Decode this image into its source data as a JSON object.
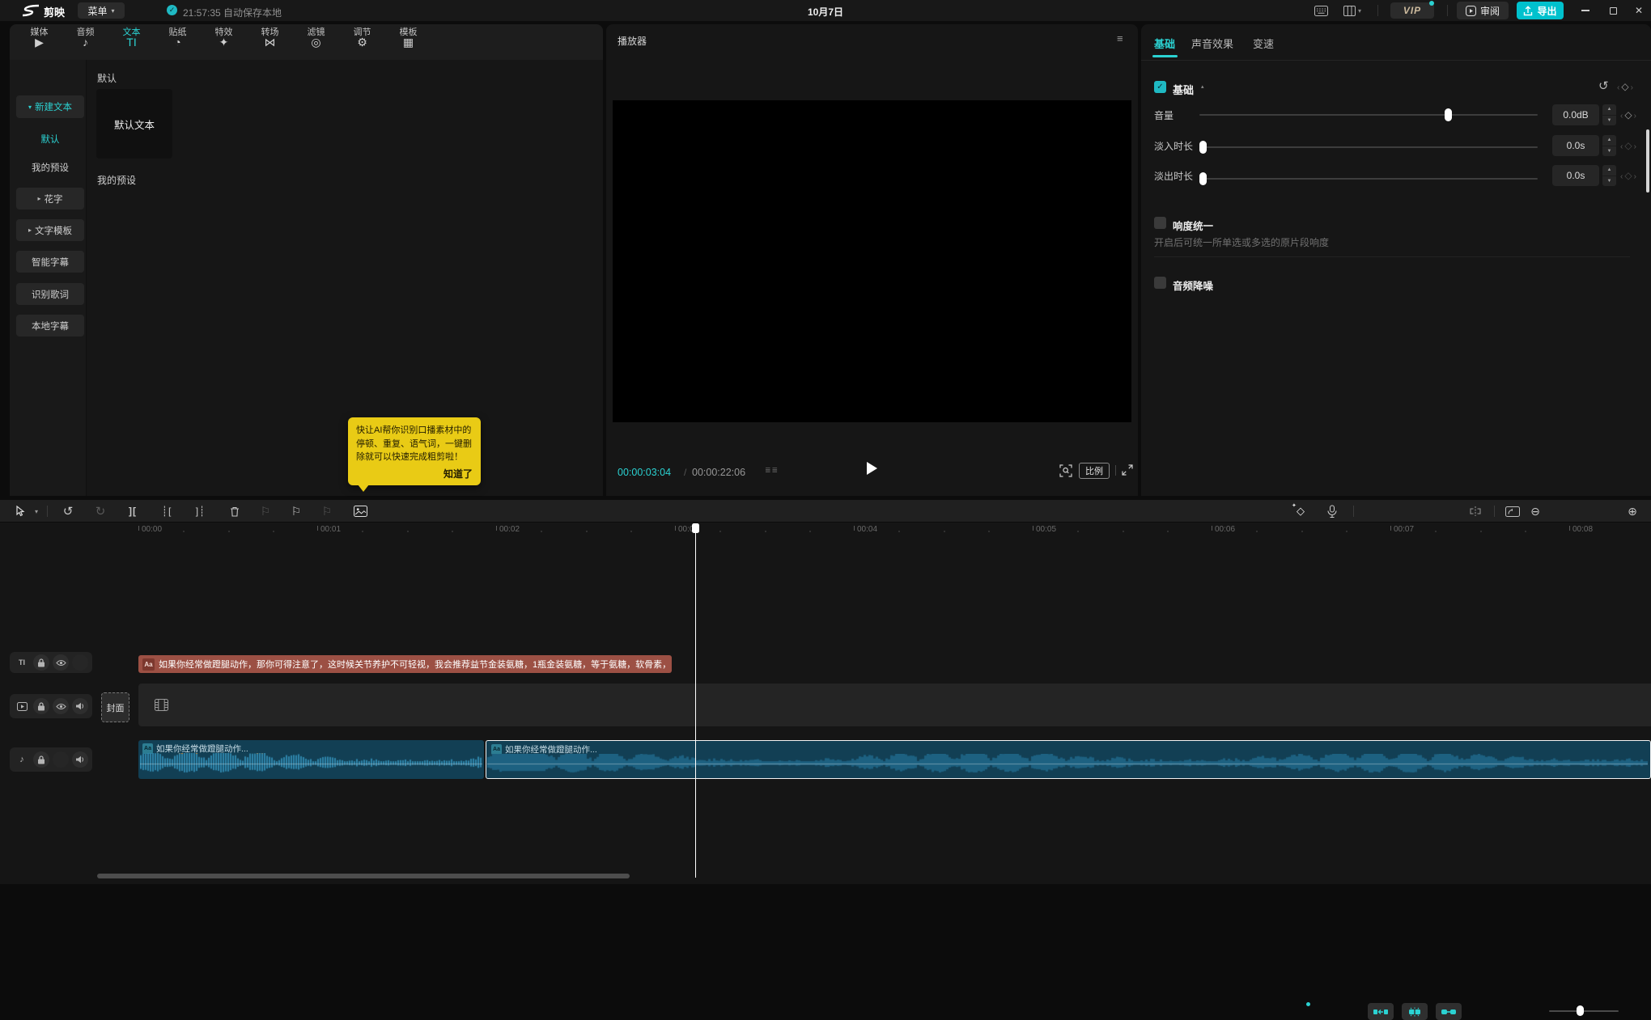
{
  "colors": {
    "accent": "#2bd2d2",
    "export_btn": "#00c1cd",
    "tooltip_bg": "#e9cb15",
    "text_clip": "#9c5044",
    "audio_clip": "#123f54",
    "wave": "#2f86ab",
    "wave_solid": "#1d6181",
    "wave_peak": "#cf8b3c"
  },
  "topbar": {
    "app": "剪映",
    "menu": "菜单",
    "autosave": "21:57:35 自动保存本地",
    "date": "10月7日",
    "vip": "VIP",
    "review": "审阅",
    "export": "导出"
  },
  "ribbon": {
    "tabs": [
      {
        "label": "媒体",
        "icon": "media"
      },
      {
        "label": "音频",
        "icon": "audio"
      },
      {
        "label": "文本",
        "icon": "text",
        "active": true
      },
      {
        "label": "贴纸",
        "icon": "sticker"
      },
      {
        "label": "特效",
        "icon": "effects"
      },
      {
        "label": "转场",
        "icon": "transition"
      },
      {
        "label": "滤镜",
        "icon": "filter"
      },
      {
        "label": "调节",
        "icon": "adjust"
      },
      {
        "label": "模板",
        "icon": "template"
      }
    ]
  },
  "sidebar": {
    "items": [
      {
        "label": "新建文本",
        "caret": "down",
        "boxed": true,
        "active": true,
        "key": "new-text"
      },
      {
        "label": "默认",
        "active": true,
        "key": "default"
      },
      {
        "label": "我的预设",
        "key": "my-presets"
      },
      {
        "label": "花字",
        "caret": "right",
        "boxed": true,
        "key": "fancy-text"
      },
      {
        "label": "文字模板",
        "caret": "right",
        "boxed": true,
        "key": "text-template"
      },
      {
        "label": "智能字幕",
        "boxed": true,
        "key": "smart-captions"
      },
      {
        "label": "识别歌词",
        "boxed": true,
        "key": "recognize-lyrics"
      },
      {
        "label": "本地字幕",
        "boxed": true,
        "key": "local-captions"
      }
    ]
  },
  "library": {
    "group1": "默认",
    "card": "默认文本",
    "group2": "我的预设"
  },
  "tooltip": {
    "text": "快让AI帮你识别口播素材中的停顿、重复、语气词，一键删除就可以快速完成粗剪啦！",
    "button": "知道了"
  },
  "player": {
    "title": "播放器",
    "current": "00:00:03:04",
    "separator": "/",
    "total": "00:00:22:06",
    "ratio": "比例"
  },
  "inspector": {
    "tabs": [
      {
        "label": "基础",
        "active": true
      },
      {
        "label": "声音效果"
      },
      {
        "label": "变速"
      }
    ],
    "section": {
      "label": "基础",
      "checked": true
    },
    "sliders": [
      {
        "key": "volume",
        "label": "音量",
        "value": "0.0dB",
        "pct": 0.74
      },
      {
        "key": "fade-in",
        "label": "淡入时长",
        "value": "0.0s",
        "pct": 0
      },
      {
        "key": "fade-out",
        "label": "淡出时长",
        "value": "0.0s",
        "pct": 0
      }
    ],
    "loudness": {
      "label": "响度统一",
      "checked": false,
      "desc": "开启后可统一所单选或多选的原片段响度"
    },
    "denoise": {
      "label": "音频降噪",
      "checked": false
    }
  },
  "timeline": {
    "ruler": [
      "00:00",
      "00:01",
      "00:02",
      "00:03",
      "00:04",
      "00:05",
      "00:06",
      "00:07",
      "00:08"
    ],
    "cover": "封面",
    "text_clip": {
      "badge": "Aa",
      "text": "如果你经常做蹬腿动作，那你可得注意了，这时候关节养护不可轻视，我会推荐益节金装氨糖，1瓶金装氨糖，等于氨糖，软骨素，MSM，透明"
    },
    "audio_clips": [
      {
        "badge": "Aa",
        "label": "如果你经常做蹬腿动作...",
        "selected": false
      },
      {
        "badge": "Aa",
        "label": "如果你经常做蹬腿动作...",
        "selected": true
      }
    ]
  }
}
